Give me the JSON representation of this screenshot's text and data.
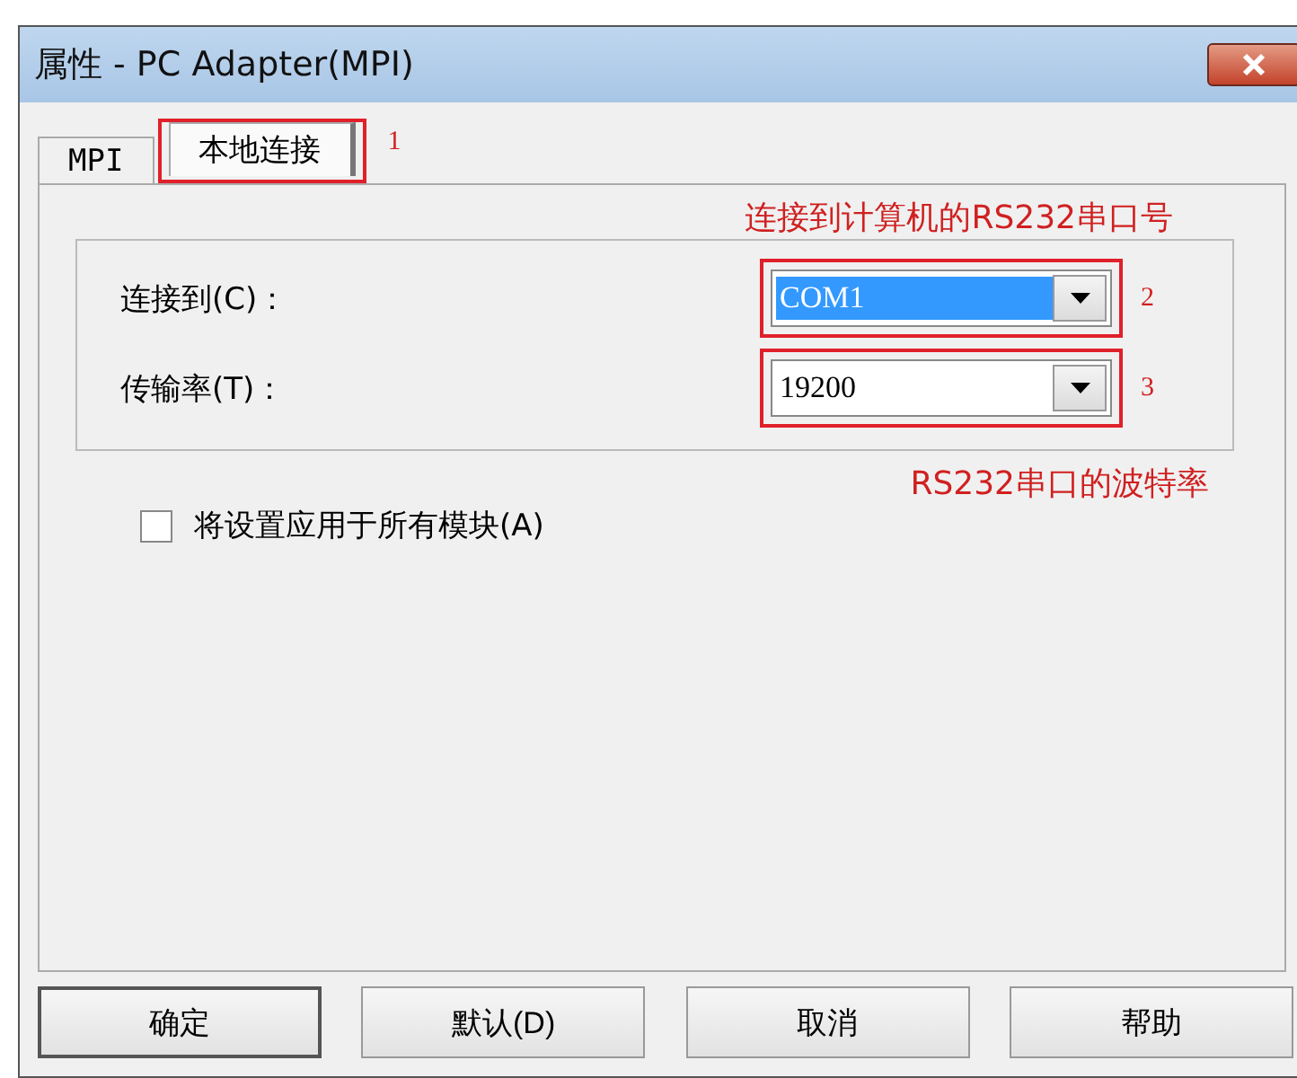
{
  "window": {
    "title": "属性 - PC Adapter(MPI)"
  },
  "tabs": [
    {
      "label": "MPI",
      "selected": false
    },
    {
      "label": "本地连接",
      "selected": true,
      "annotation": "1"
    }
  ],
  "notes": [
    "连接到计算机的RS232串口号",
    "RS232串口的波特率"
  ],
  "fields": [
    {
      "label": "连接到(C)：",
      "value": "COM1",
      "highlighted": true,
      "annotation": "2"
    },
    {
      "label": "传输率(T)：",
      "value": "19200",
      "highlighted": false,
      "annotation": "3"
    }
  ],
  "checkbox": {
    "label": "将设置应用于所有模块(A)",
    "checked": false
  },
  "buttons": [
    {
      "label": "确定",
      "default": true
    },
    {
      "label": "默认(D)",
      "default": false
    },
    {
      "label": "取消",
      "default": false
    },
    {
      "label": "帮助",
      "default": false
    }
  ]
}
